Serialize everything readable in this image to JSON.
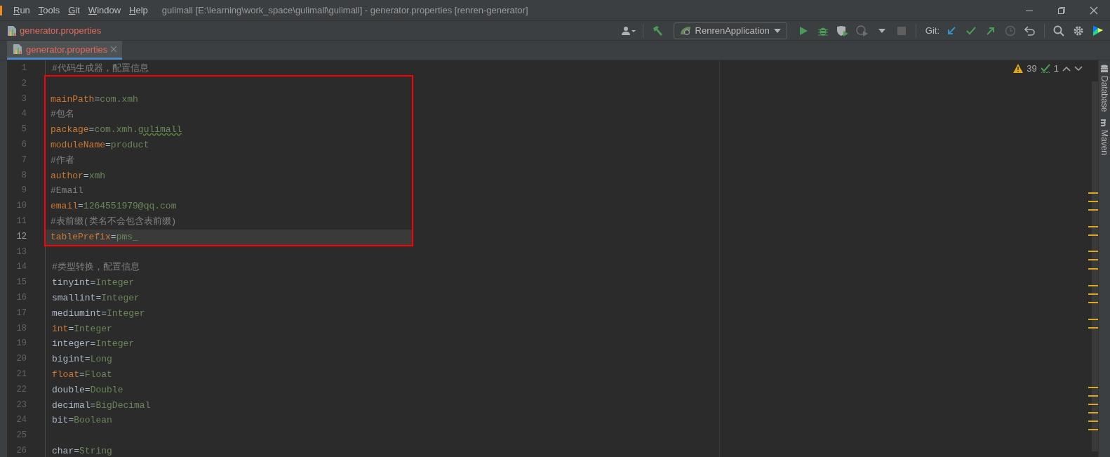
{
  "menu": [
    {
      "label": "Run"
    },
    {
      "label": "Tools"
    },
    {
      "label": "Git"
    },
    {
      "label": "Window"
    },
    {
      "label": "Help"
    }
  ],
  "window": {
    "title": "gulimall [E:\\learning\\work_space\\gulimall\\gulimall] - generator.properties [renren-generator]"
  },
  "breadcrumb": {
    "file": "generator.properties"
  },
  "toolbar": {
    "run_configuration": "RenrenApplication",
    "git_label": "Git:"
  },
  "tabs": [
    {
      "label": "generator.properties",
      "selected": true
    }
  ],
  "inspections": {
    "warnings": "39",
    "typos": "1"
  },
  "side_panels": [
    {
      "label": "Database"
    },
    {
      "label": "Maven"
    }
  ],
  "blocks": [
    {
      "boxed": false,
      "lines": [
        {
          "number": "1",
          "kind": "comment",
          "text": "#代码生成器，配置信息",
          "current": false
        }
      ]
    },
    {
      "boxed": true,
      "lines": [
        {
          "number": "2",
          "kind": "blank",
          "current": false
        },
        {
          "number": "3",
          "kind": "keyword_property",
          "key": "mainPath",
          "separator": "=",
          "value": "com.xmh",
          "current": false
        },
        {
          "number": "4",
          "kind": "comment",
          "text": "#包名",
          "current": false
        },
        {
          "number": "5",
          "kind": "keyword_property",
          "key": "package",
          "separator": "=",
          "value": "com.xmh.",
          "flagged": "gulimall",
          "current": false
        },
        {
          "number": "6",
          "kind": "keyword_property",
          "key": "moduleName",
          "separator": "=",
          "value": "product",
          "current": false
        },
        {
          "number": "7",
          "kind": "comment",
          "text": "#作者",
          "current": false
        },
        {
          "number": "8",
          "kind": "keyword_property",
          "key": "author",
          "separator": "=",
          "value": "xmh",
          "current": false
        },
        {
          "number": "9",
          "kind": "comment",
          "text": "#Email",
          "current": false
        },
        {
          "number": "10",
          "kind": "keyword_property",
          "key": "email",
          "separator": "=",
          "value": "1264551979@qq.com",
          "current": false
        },
        {
          "number": "11",
          "kind": "comment",
          "text": "#表前缀(类名不会包含表前缀)",
          "current": false
        },
        {
          "number": "12",
          "kind": "keyword_property",
          "key": "tablePrefix",
          "separator": "=",
          "value": "pms_",
          "current": true
        }
      ]
    },
    {
      "boxed": false,
      "lines": [
        {
          "number": "13",
          "kind": "blank",
          "current": false
        },
        {
          "number": "14",
          "kind": "comment",
          "text": "#类型转换，配置信息",
          "current": false
        },
        {
          "number": "15",
          "kind": "property",
          "key": "tinyint",
          "separator": "=",
          "value": "Integer",
          "current": false
        },
        {
          "number": "16",
          "kind": "property",
          "key": "smallint",
          "separator": "=",
          "value": "Integer",
          "current": false
        },
        {
          "number": "17",
          "kind": "property",
          "key": "mediumint",
          "separator": "=",
          "value": "Integer",
          "current": false
        },
        {
          "number": "18",
          "kind": "keyword_property",
          "key": "int",
          "separator": "=",
          "value": "Integer",
          "current": false
        },
        {
          "number": "19",
          "kind": "property",
          "key": "integer",
          "separator": "=",
          "value": "Integer",
          "current": false
        },
        {
          "number": "20",
          "kind": "property",
          "key": "bigint",
          "separator": "=",
          "value": "Long",
          "current": false
        },
        {
          "number": "21",
          "kind": "keyword_property",
          "key": "float",
          "separator": "=",
          "value": "Float",
          "current": false
        },
        {
          "number": "22",
          "kind": "property",
          "key": "double",
          "separator": "=",
          "value": "Double",
          "current": false
        },
        {
          "number": "23",
          "kind": "property",
          "key": "decimal",
          "separator": "=",
          "value": "BigDecimal",
          "current": false
        },
        {
          "number": "24",
          "kind": "property",
          "key": "bit",
          "separator": "=",
          "value": "Boolean",
          "current": false
        },
        {
          "number": "25",
          "kind": "blank",
          "current": false
        },
        {
          "number": "26",
          "kind": "property",
          "key": "char",
          "separator": "=",
          "value": "String",
          "current": false
        }
      ]
    }
  ]
}
